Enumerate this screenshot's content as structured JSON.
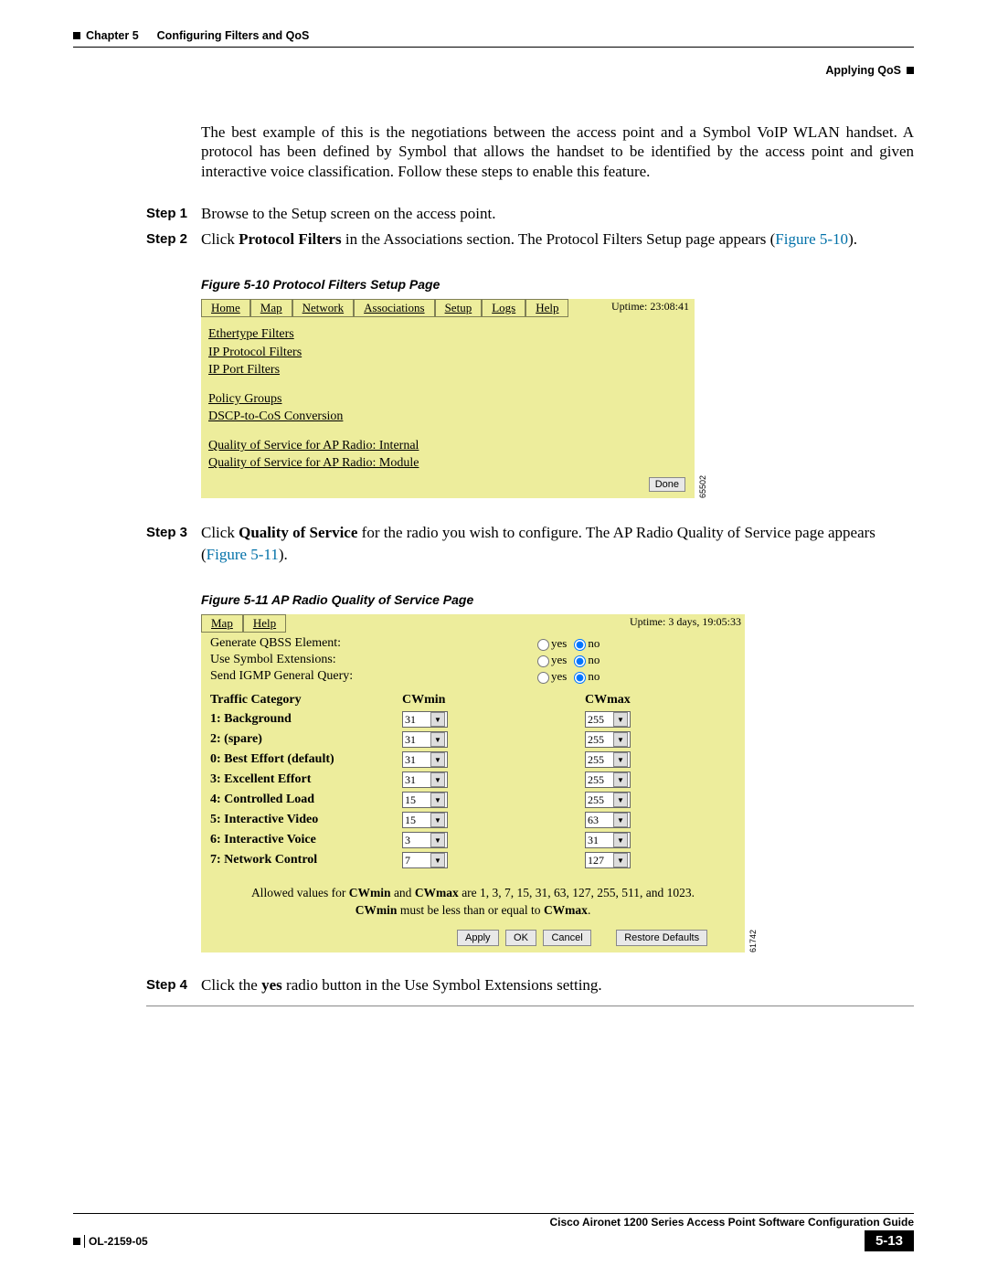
{
  "header": {
    "chapter": "Chapter 5",
    "chapter_title": "Configuring Filters and QoS",
    "section": "Applying QoS"
  },
  "intro_para": "The best example of this is the negotiations between the access point and a Symbol VoIP WLAN handset. A protocol has been defined by Symbol that allows the handset to be identified by the access point and given interactive voice classification. Follow these steps to enable this feature.",
  "steps": {
    "s1_label": "Step 1",
    "s1_body": "Browse to the Setup screen on the access point.",
    "s2_label": "Step 2",
    "s2_body_pre": "Click ",
    "s2_body_bold": "Protocol Filters",
    "s2_body_mid": " in the Associations section. The Protocol Filters Setup page appears (",
    "s2_body_ref": "Figure 5-10",
    "s2_body_post": ").",
    "s3_label": "Step 3",
    "s3_body_pre": "Click ",
    "s3_body_bold": "Quality of Service",
    "s3_body_mid": " for the radio you wish to configure. The AP Radio Quality of Service page appears (",
    "s3_body_ref": "Figure 5-11",
    "s3_body_post": ").",
    "s4_label": "Step 4",
    "s4_body_pre": "Click the ",
    "s4_body_bold": "yes",
    "s4_body_post": " radio button in the Use Symbol Extensions setting."
  },
  "fig10": {
    "caption": "Figure 5-10   Protocol Filters Setup Page",
    "nav": [
      "Home",
      "Map",
      "Network",
      "Associations",
      "Setup",
      "Logs",
      "Help"
    ],
    "uptime": "Uptime: 23:08:41",
    "links_g1": [
      "Ethertype Filters",
      "IP Protocol Filters",
      "IP Port Filters"
    ],
    "links_g2": [
      "Policy Groups",
      "DSCP-to-CoS Conversion"
    ],
    "links_g3": [
      "Quality of Service for AP Radio: Internal",
      "Quality of Service for AP Radio: Module"
    ],
    "done": "Done",
    "imgnum": "65502"
  },
  "fig11": {
    "caption": "Figure 5-11   AP Radio Quality of Service Page",
    "nav": [
      "Map",
      "Help"
    ],
    "uptime": "Uptime: 3 days, 19:05:33",
    "opts": [
      {
        "label": "Generate QBSS Element:",
        "sel": "no"
      },
      {
        "label": "Use Symbol Extensions:",
        "sel": "no"
      },
      {
        "label": "Send IGMP General Query:",
        "sel": "no"
      }
    ],
    "yes": "yes",
    "no": "no",
    "th1": "Traffic Category",
    "th2": "CWmin",
    "th3": "CWmax",
    "rows": [
      {
        "name": "1: Background",
        "min": "31",
        "max": "255"
      },
      {
        "name": "2: (spare)",
        "min": "31",
        "max": "255"
      },
      {
        "name": "0: Best Effort (default)",
        "min": "31",
        "max": "255"
      },
      {
        "name": "3: Excellent Effort",
        "min": "31",
        "max": "255"
      },
      {
        "name": "4: Controlled Load",
        "min": "15",
        "max": "255"
      },
      {
        "name": "5: Interactive Video",
        "min": "15",
        "max": "63"
      },
      {
        "name": "6: Interactive Voice",
        "min": "3",
        "max": "31"
      },
      {
        "name": "7: Network Control",
        "min": "7",
        "max": "127"
      }
    ],
    "note_pre": "Allowed values for ",
    "note_b1": "CWmin",
    "note_mid1": " and ",
    "note_b2": "CWmax",
    "note_mid2": " are 1, 3, 7, 15, 31, 63, 127, 255, 511, and 1023.",
    "note_l2_b1": "CWmin",
    "note_l2_mid": " must be less than or equal to ",
    "note_l2_b2": "CWmax",
    "note_l2_end": ".",
    "buttons": [
      "Apply",
      "OK",
      "Cancel",
      "Restore Defaults"
    ],
    "imgnum": "61742"
  },
  "footer": {
    "guide": "Cisco Aironet 1200 Series Access Point Software Configuration Guide",
    "doc": "OL-2159-05",
    "page": "5-13"
  }
}
